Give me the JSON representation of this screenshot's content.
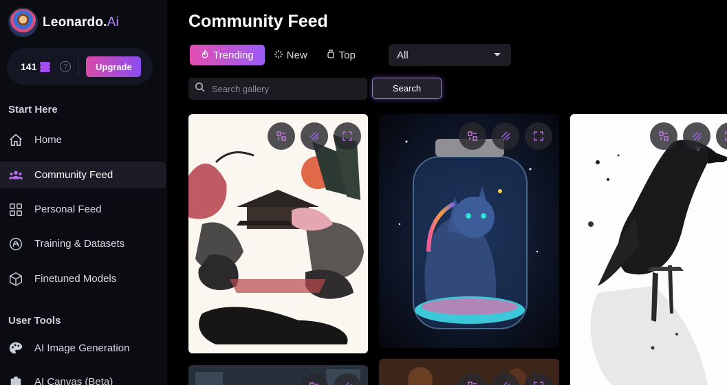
{
  "brand": {
    "name": "Leonardo.",
    "name_suffix": "Ai"
  },
  "credits": {
    "count": "141",
    "help": "?",
    "upgrade_label": "Upgrade"
  },
  "sidebar": {
    "section_start": "Start Here",
    "section_tools": "User Tools",
    "items": [
      {
        "label": "Home",
        "icon": "home-icon"
      },
      {
        "label": "Community Feed",
        "icon": "people-icon",
        "active": true
      },
      {
        "label": "Personal Feed",
        "icon": "grid-icon"
      },
      {
        "label": "Training & Datasets",
        "icon": "training-icon"
      },
      {
        "label": "Finetuned Models",
        "icon": "cube-icon"
      },
      {
        "label": "AI Image Generation",
        "icon": "palette-icon"
      },
      {
        "label": "AI Canvas (Beta)",
        "icon": "canvas-icon"
      }
    ]
  },
  "main": {
    "title": "Community Feed",
    "tabs": [
      {
        "label": "Trending",
        "icon": "flame-icon",
        "active": true
      },
      {
        "label": "New",
        "icon": "loader-icon"
      },
      {
        "label": "Top",
        "icon": "trophy-icon"
      }
    ],
    "filter": {
      "selected": "All"
    },
    "search": {
      "placeholder": "Search gallery",
      "button_label": "Search"
    }
  },
  "colors": {
    "accent_pink": "#e24fb1",
    "accent_purple": "#9a5cf5",
    "sidebar_bg": "#0b0c12"
  }
}
